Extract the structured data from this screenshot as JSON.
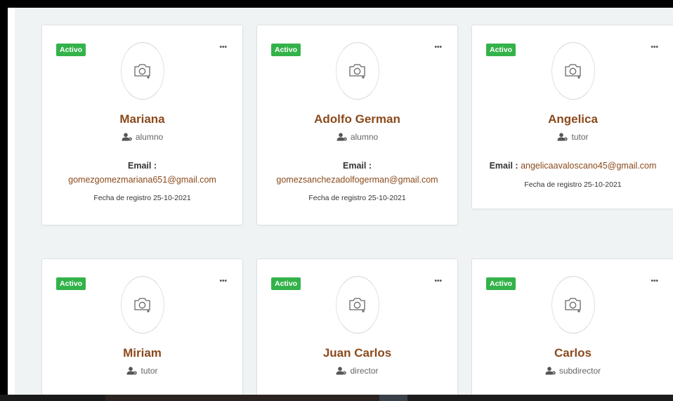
{
  "cards": [
    {
      "status": "Activo",
      "menu": "•••",
      "name": "Mariana",
      "role": "alumno",
      "email_label": "Email :",
      "email": "gomezgomezmariana651@gmail.com",
      "date": "Fecha de registro 25-10-2021"
    },
    {
      "status": "Activo",
      "menu": "•••",
      "name": "Adolfo German",
      "role": "alumno",
      "email_label": "Email :",
      "email": "gomezsanchezadolfogerman@gmail.com",
      "date": "Fecha de registro 25-10-2021"
    },
    {
      "status": "Activo",
      "menu": "•••",
      "name": "Angelica",
      "role": "tutor",
      "email_label": "Email :",
      "email": "angelicaavaloscano45@gmail.com",
      "date": "Fecha de registro 25-10-2021"
    },
    {
      "status": "Activo",
      "menu": "•••",
      "name": "Miriam",
      "role": "tutor"
    },
    {
      "status": "Activo",
      "menu": "•••",
      "name": "Juan Carlos",
      "role": "director"
    },
    {
      "status": "Activo",
      "menu": "•••",
      "name": "Carlos",
      "role": "subdirector"
    }
  ],
  "icons": {
    "avatar_placeholder": "camera-add-icon",
    "role": "user-gear-icon"
  },
  "colors": {
    "name": "#8b4a1c",
    "badge": "#34b24a",
    "background": "#f0f3f4"
  }
}
